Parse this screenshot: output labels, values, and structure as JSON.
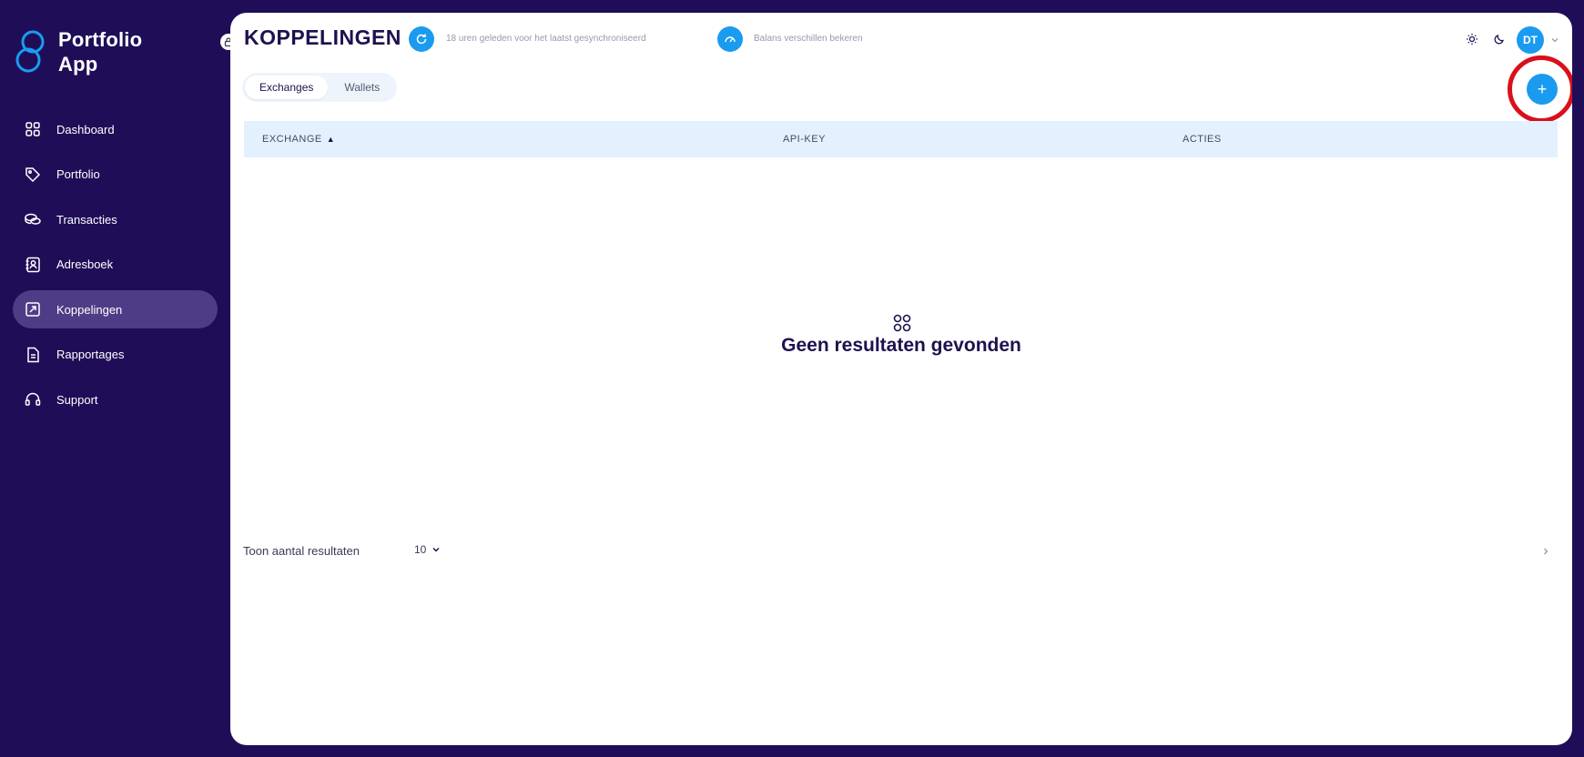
{
  "app": {
    "name_line1": "Portfolio",
    "name_line2": "App",
    "accent_color": "#1a9bf0",
    "sidebar_color": "#1f0e57"
  },
  "sidebar": {
    "items": [
      {
        "label": "Dashboard",
        "icon": "grid-icon",
        "active": false
      },
      {
        "label": "Portfolio",
        "icon": "tag-icon",
        "active": false
      },
      {
        "label": "Transacties",
        "icon": "coins-icon",
        "active": false
      },
      {
        "label": "Adresboek",
        "icon": "address-book-icon",
        "active": false
      },
      {
        "label": "Koppelingen",
        "icon": "link-icon",
        "active": true
      },
      {
        "label": "Rapportages",
        "icon": "document-icon",
        "active": false
      },
      {
        "label": "Support",
        "icon": "headset-icon",
        "active": false
      }
    ]
  },
  "header": {
    "title": "KOPPELINGEN",
    "sync_text": "18 uren geleden voor het laatst gesynchroniseerd",
    "balance_text": "Balans verschillen bekeren",
    "user_initials": "DT"
  },
  "tabs": [
    {
      "label": "Exchanges",
      "active": true
    },
    {
      "label": "Wallets",
      "active": false
    }
  ],
  "add_button": {
    "label": "+"
  },
  "table": {
    "columns": [
      "EXCHANGE",
      "API-KEY",
      "ACTIES"
    ],
    "sort_indicator": "▲",
    "rows": [],
    "empty_text": "Geen resultaten gevonden"
  },
  "pagination": {
    "page_size_label": "Toon aantal resultaten",
    "page_size": "10"
  },
  "highlight_color": "#d9101b"
}
